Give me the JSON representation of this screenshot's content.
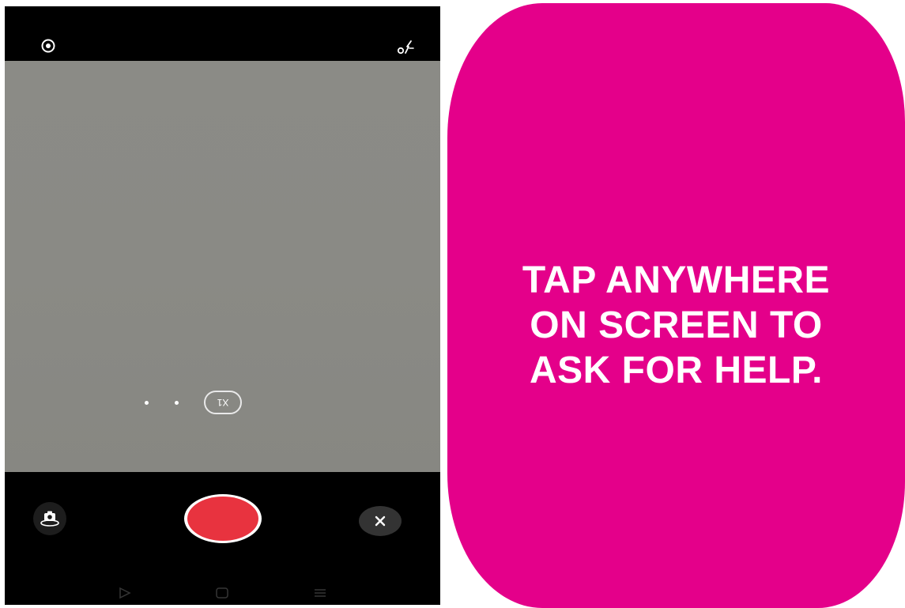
{
  "camera": {
    "zoom_label": "X1",
    "icons": {
      "eye": "eye-icon",
      "flash": "flash-auto-icon",
      "switch_camera": "switch-camera-icon",
      "close": "close-icon",
      "nav_back": "nav-back-icon",
      "nav_home": "nav-home-icon",
      "nav_menu": "nav-menu-icon"
    },
    "colors": {
      "record": "#e8333f",
      "viewfinder": "#8a8a85"
    }
  },
  "help_panel": {
    "lines": [
      "TAP ANYWHERE",
      "ON SCREEN TO",
      "ASK FOR HELP."
    ],
    "background": "#e4008a"
  }
}
